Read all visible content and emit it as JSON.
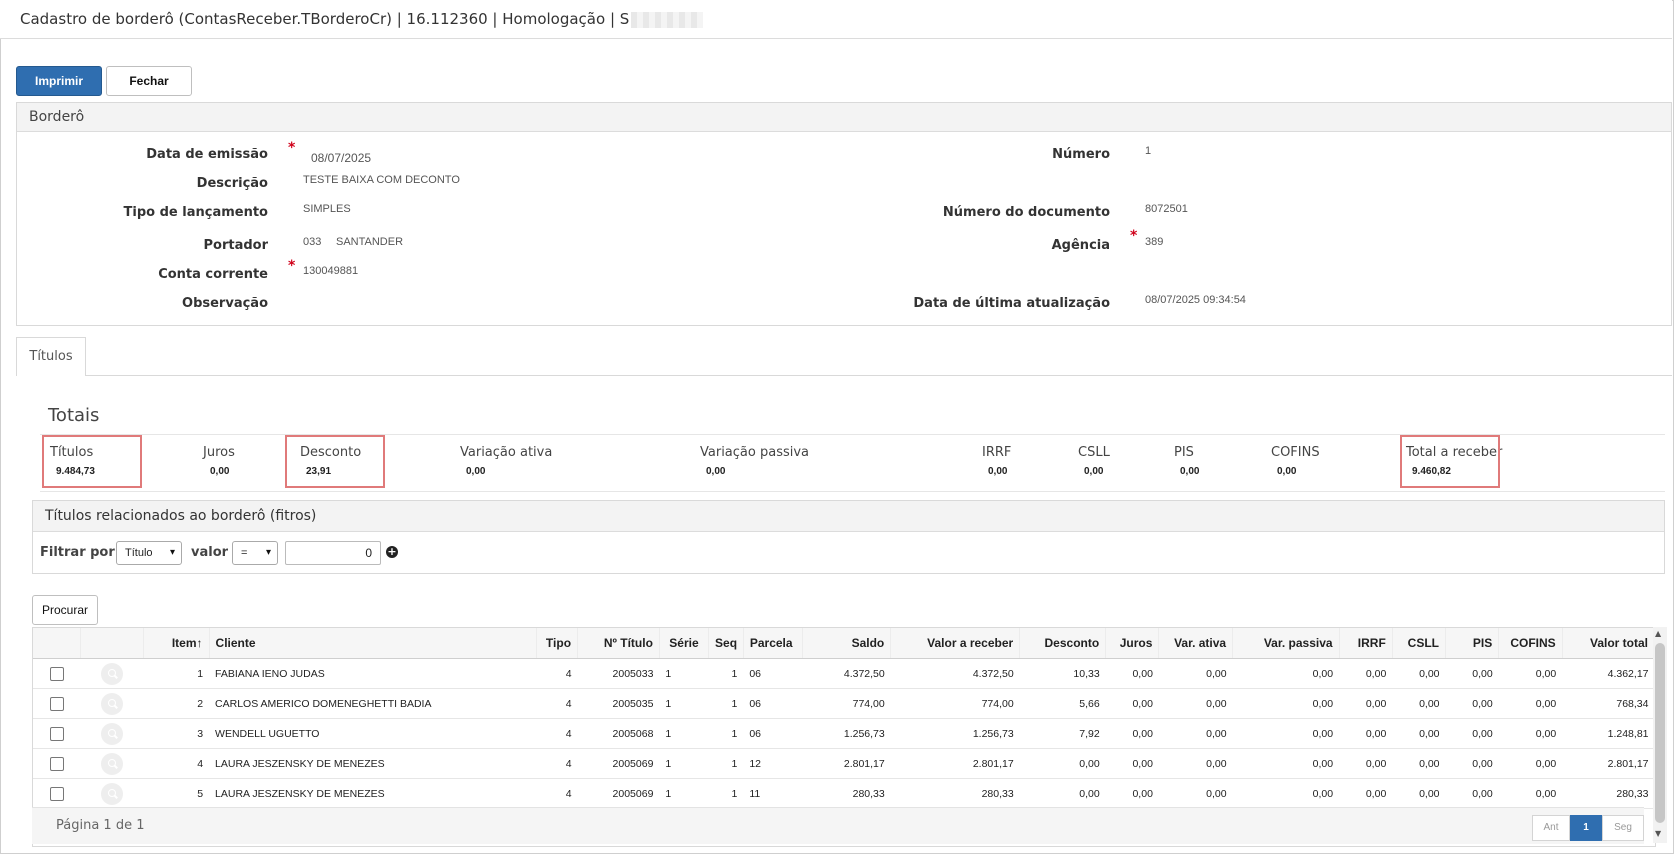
{
  "window": {
    "title": "Cadastro de borderô (ContasReceber.TBorderoCr) | 16.112360 | Homologação | S"
  },
  "toolbar": {
    "print_label": "Imprimir",
    "close_label": "Fechar"
  },
  "bordero": {
    "section_title": "Borderô",
    "fields": {
      "data_emissao": {
        "label": "Data de emissão",
        "value": "08/07/2025"
      },
      "descricao": {
        "label": "Descrição",
        "value": "TESTE BAIXA COM DECONTO"
      },
      "tipo_lancamento": {
        "label": "Tipo de lançamento",
        "value": "SIMPLES"
      },
      "portador": {
        "label": "Portador",
        "code": "033",
        "name": "SANTANDER"
      },
      "conta_corrente": {
        "label": "Conta corrente",
        "value": "130049881"
      },
      "observacao": {
        "label": "Observação",
        "value": ""
      },
      "numero": {
        "label": "Número",
        "value": "1"
      },
      "numero_documento": {
        "label": "Número do documento",
        "value": "8072501"
      },
      "agencia": {
        "label": "Agência",
        "value": "389"
      },
      "data_ultima_atualizacao": {
        "label": "Data de última atualização",
        "value": "08/07/2025 09:34:54"
      }
    },
    "required_marker": "*"
  },
  "tabs": [
    {
      "label": "Títulos",
      "active": true
    }
  ],
  "totais": {
    "title": "Totais",
    "items": [
      {
        "label": "Títulos",
        "value": "9.484,73",
        "highlighted": true
      },
      {
        "label": "Juros",
        "value": "0,00",
        "highlighted": false
      },
      {
        "label": "Desconto",
        "value": "23,91",
        "highlighted": true
      },
      {
        "label": "Variação ativa",
        "value": "0,00",
        "highlighted": false
      },
      {
        "label": "Variação passiva",
        "value": "0,00",
        "highlighted": false
      },
      {
        "label": "IRRF",
        "value": "0,00",
        "highlighted": false
      },
      {
        "label": "CSLL",
        "value": "0,00",
        "highlighted": false
      },
      {
        "label": "PIS",
        "value": "0,00",
        "highlighted": false
      },
      {
        "label": "COFINS",
        "value": "0,00",
        "highlighted": false
      },
      {
        "label": "Total a receber",
        "value": "9.460,82",
        "highlighted": true
      }
    ]
  },
  "filter": {
    "title": "Títulos relacionados ao borderô (fitros)",
    "filter_by_label": "Filtrar por",
    "filter_by_value": "Título",
    "value_label": "valor",
    "operator_value": "=",
    "input_value": "0",
    "search_label": "Procurar"
  },
  "grid": {
    "columns": [
      "",
      "",
      "Item",
      "Cliente",
      "Tipo",
      "Nº Título",
      "Série",
      "Seq",
      "Parcela",
      "Saldo",
      "Valor a receber",
      "Desconto",
      "Juros",
      "Var. ativa",
      "Var. passiva",
      "IRRF",
      "CSLL",
      "PIS",
      "COFINS",
      "Valor total"
    ],
    "sort_indicator": "↑",
    "rows": [
      {
        "item": "1",
        "cliente": "FABIANA IENO JUDAS",
        "tipo": "4",
        "titulo": "2005033",
        "serie": "1",
        "seq": "1",
        "parcela": "06",
        "saldo": "4.372,50",
        "valor_receber": "4.372,50",
        "desconto": "10,33",
        "juros": "0,00",
        "var_ativa": "0,00",
        "var_passiva": "0,00",
        "irrf": "0,00",
        "csll": "0,00",
        "pis": "0,00",
        "cofins": "0,00",
        "valor_total": "4.362,17"
      },
      {
        "item": "2",
        "cliente": "CARLOS AMERICO DOMENEGHETTI BADIA",
        "tipo": "4",
        "titulo": "2005035",
        "serie": "1",
        "seq": "1",
        "parcela": "06",
        "saldo": "774,00",
        "valor_receber": "774,00",
        "desconto": "5,66",
        "juros": "0,00",
        "var_ativa": "0,00",
        "var_passiva": "0,00",
        "irrf": "0,00",
        "csll": "0,00",
        "pis": "0,00",
        "cofins": "0,00",
        "valor_total": "768,34"
      },
      {
        "item": "3",
        "cliente": "WENDELL UGUETTO",
        "tipo": "4",
        "titulo": "2005068",
        "serie": "1",
        "seq": "1",
        "parcela": "06",
        "saldo": "1.256,73",
        "valor_receber": "1.256,73",
        "desconto": "7,92",
        "juros": "0,00",
        "var_ativa": "0,00",
        "var_passiva": "0,00",
        "irrf": "0,00",
        "csll": "0,00",
        "pis": "0,00",
        "cofins": "0,00",
        "valor_total": "1.248,81"
      },
      {
        "item": "4",
        "cliente": "LAURA JESZENSKY DE MENEZES",
        "tipo": "4",
        "titulo": "2005069",
        "serie": "1",
        "seq": "1",
        "parcela": "12",
        "saldo": "2.801,17",
        "valor_receber": "2.801,17",
        "desconto": "0,00",
        "juros": "0,00",
        "var_ativa": "0,00",
        "var_passiva": "0,00",
        "irrf": "0,00",
        "csll": "0,00",
        "pis": "0,00",
        "cofins": "0,00",
        "valor_total": "2.801,17"
      },
      {
        "item": "5",
        "cliente": "LAURA JESZENSKY DE MENEZES",
        "tipo": "4",
        "titulo": "2005069",
        "serie": "1",
        "seq": "1",
        "parcela": "11",
        "saldo": "280,33",
        "valor_receber": "280,33",
        "desconto": "0,00",
        "juros": "0,00",
        "var_ativa": "0,00",
        "var_passiva": "0,00",
        "irrf": "0,00",
        "csll": "0,00",
        "pis": "0,00",
        "cofins": "0,00",
        "valor_total": "280,33"
      }
    ]
  },
  "pagination": {
    "summary": "Página 1 de 1",
    "prev_label": "Ant",
    "current_label": "1",
    "next_label": "Seg"
  },
  "colors": {
    "primary": "#2f6eb0",
    "required": "#d0021b",
    "highlight": "#e07a7a"
  }
}
